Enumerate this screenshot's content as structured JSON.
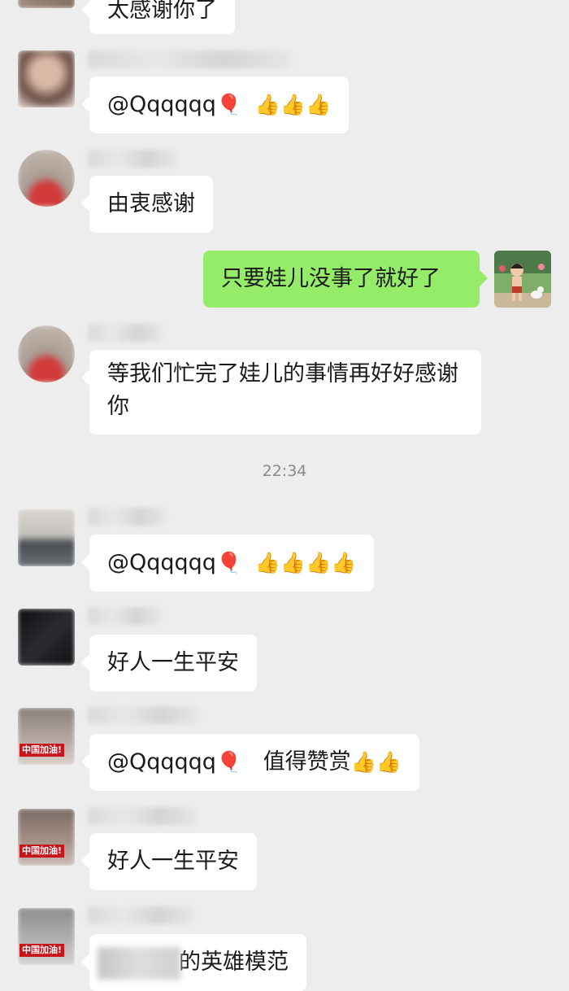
{
  "messages": {
    "m0": {
      "text": "太感谢你了"
    },
    "m1": {
      "mention": "@Qqqqqq",
      "balloon": "🎈",
      "thumbs": "👍👍👍"
    },
    "m2": {
      "text": "由衷感谢"
    },
    "m3": {
      "text": "只要娃儿没事了就好了"
    },
    "m4": {
      "text": "等我们忙完了娃儿的事情再好好感谢你"
    },
    "m5": {
      "mention": "@Qqqqqq",
      "balloon": "🎈",
      "thumbs": "👍👍👍👍"
    },
    "m6": {
      "text": "好人一生平安"
    },
    "m7": {
      "mention": "@Qqqqqq",
      "balloon": "🎈",
      "text": "值得赞赏",
      "thumbs": "👍👍"
    },
    "m8": {
      "text": "好人一生平安"
    },
    "m9": {
      "text": "的英雄模范"
    }
  },
  "timestamp": "22:34",
  "avatar_badge": "中国加油!",
  "colors": {
    "background": "#ededed",
    "bubble_incoming": "#ffffff",
    "bubble_outgoing": "#95ec69",
    "badge_red": "#c8141b"
  }
}
